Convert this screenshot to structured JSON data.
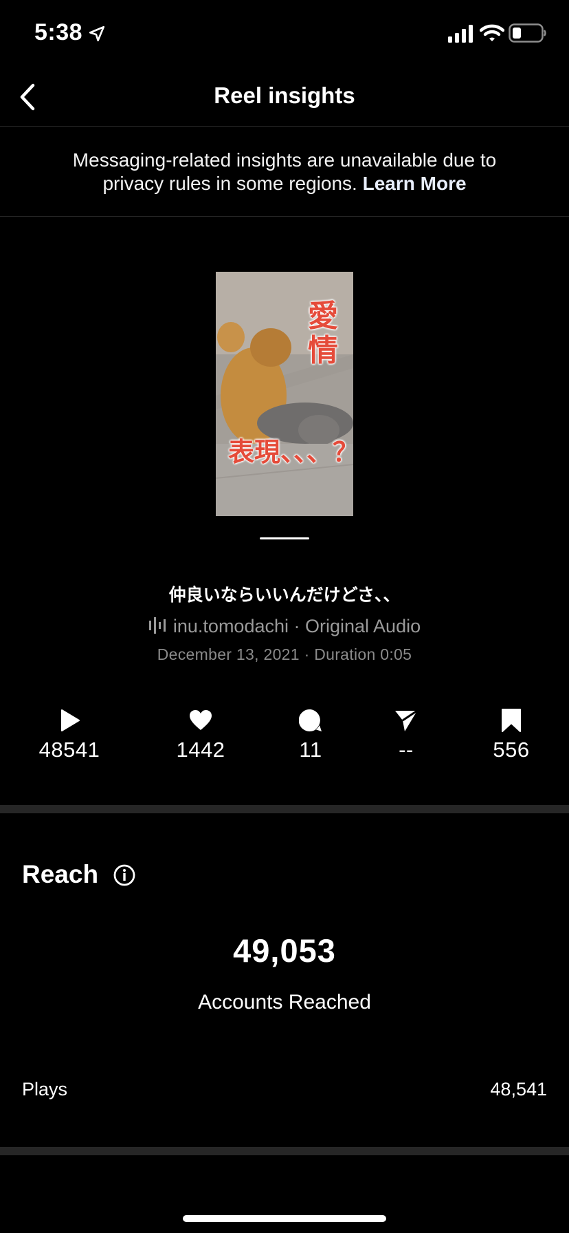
{
  "status_bar": {
    "time": "5:38",
    "icons": [
      "location-arrow-icon",
      "cellular-signal-icon",
      "wifi-icon",
      "battery-icon"
    ]
  },
  "nav": {
    "title": "Reel insights",
    "back_icon": "chevron-left-icon"
  },
  "notice": {
    "text": "Messaging-related insights are unavailable due to privacy rules in some regions.",
    "link": "Learn More"
  },
  "reel": {
    "thumbnail_text_top": "愛情",
    "thumbnail_text_bottom": "表現、、、？",
    "caption": "仲良いならいいんだけどさ、、",
    "account": "inu.tomodachi",
    "audio_separator": " · ",
    "audio": "Original Audio",
    "date": "December 13, 2021",
    "meta_separator": " · ",
    "duration_label": "Duration",
    "duration": "0:05"
  },
  "stats": {
    "plays": "48541",
    "likes": "1442",
    "comments": "11",
    "shares": "--",
    "saves": "556"
  },
  "reach": {
    "title": "Reach",
    "value": "49,053",
    "label": "Accounts Reached",
    "plays_label": "Plays",
    "plays_value": "48,541"
  },
  "colors": {
    "background": "#000000",
    "divider": "#262626",
    "secondary_text": "#9a9a9a",
    "thumbnail_text": "#e54b3a"
  }
}
